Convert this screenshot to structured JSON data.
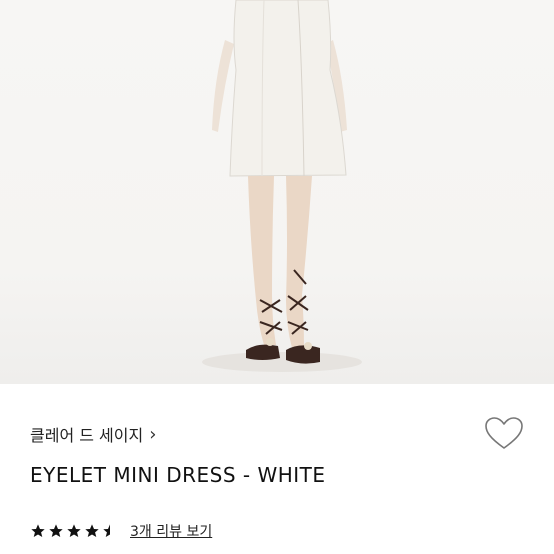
{
  "product": {
    "brand_label": "클레어 드 세이지",
    "title": "EYELET MINI DRESS - WHITE",
    "rating": 4.5,
    "rating_max": 5,
    "review_link_label": "3개 리뷰 보기"
  },
  "icons": {
    "brand_chevron": "chevron-right-icon",
    "wishlist": "heart-outline-icon",
    "star": "star-icon"
  },
  "colors": {
    "star": "#111111",
    "heart_outline": "#777777",
    "dress": "#f3f1ec",
    "sandal": "#3a2620"
  }
}
